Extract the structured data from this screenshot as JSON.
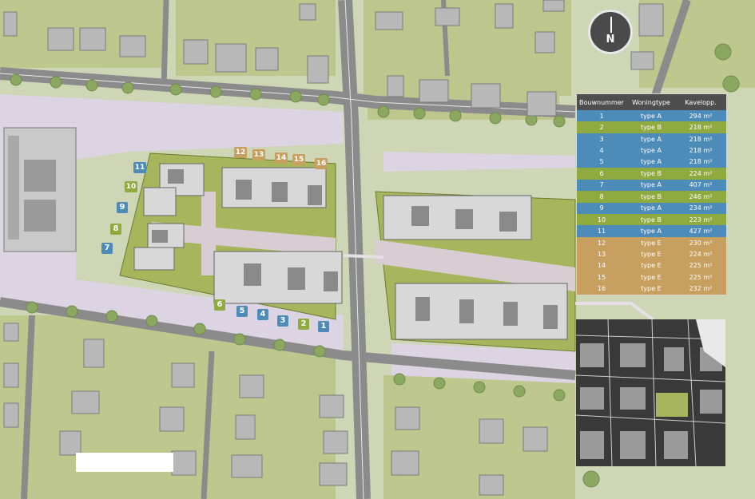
{
  "compass": {
    "letter": "N"
  },
  "colors": {
    "typeA": "#4d8bb8",
    "typeB": "#8faa3e",
    "typeE": "#c7a060",
    "street": "#e3dde8",
    "grass": "#cfd6b5",
    "parcel": "#a7b65d",
    "house": "#d9d9d9",
    "roof": "#8a8a8a"
  },
  "legend": {
    "headers": [
      "Bouwnummer",
      "Woningtype",
      "Kavelopp."
    ],
    "rows": [
      {
        "nr": "1",
        "type": "type A",
        "area": "294 m²",
        "color": "#4d8bb8"
      },
      {
        "nr": "2",
        "type": "type B",
        "area": "218 m²",
        "color": "#8faa3e"
      },
      {
        "nr": "3",
        "type": "type A",
        "area": "218 m²",
        "color": "#4d8bb8"
      },
      {
        "nr": "4",
        "type": "type A",
        "area": "218 m²",
        "color": "#4d8bb8"
      },
      {
        "nr": "5",
        "type": "type A",
        "area": "218 m²",
        "color": "#4d8bb8"
      },
      {
        "nr": "6",
        "type": "type B",
        "area": "224 m²",
        "color": "#8faa3e"
      },
      {
        "nr": "7",
        "type": "type A",
        "area": "407 m²",
        "color": "#4d8bb8"
      },
      {
        "nr": "8",
        "type": "type B",
        "area": "246 m²",
        "color": "#8faa3e"
      },
      {
        "nr": "9",
        "type": "type A",
        "area": "234 m²",
        "color": "#4d8bb8"
      },
      {
        "nr": "10",
        "type": "type B",
        "area": "223 m²",
        "color": "#8faa3e"
      },
      {
        "nr": "11",
        "type": "type A",
        "area": "427 m²",
        "color": "#4d8bb8"
      },
      {
        "nr": "12",
        "type": "type E",
        "area": "230 m²",
        "color": "#c7a060"
      },
      {
        "nr": "13",
        "type": "type E",
        "area": "224 m²",
        "color": "#c7a060"
      },
      {
        "nr": "14",
        "type": "type E",
        "area": "225 m²",
        "color": "#c7a060"
      },
      {
        "nr": "15",
        "type": "type E",
        "area": "225 m²",
        "color": "#c7a060"
      },
      {
        "nr": "16",
        "type": "type E",
        "area": "232 m²",
        "color": "#c7a060"
      }
    ]
  },
  "plot_labels": [
    {
      "nr": "1",
      "color": "#4d8bb8"
    },
    {
      "nr": "2",
      "color": "#8faa3e"
    },
    {
      "nr": "3",
      "color": "#4d8bb8"
    },
    {
      "nr": "4",
      "color": "#4d8bb8"
    },
    {
      "nr": "5",
      "color": "#4d8bb8"
    },
    {
      "nr": "6",
      "color": "#8faa3e"
    },
    {
      "nr": "7",
      "color": "#4d8bb8"
    },
    {
      "nr": "8",
      "color": "#8faa3e"
    },
    {
      "nr": "9",
      "color": "#4d8bb8"
    },
    {
      "nr": "10",
      "color": "#8faa3e"
    },
    {
      "nr": "11",
      "color": "#4d8bb8"
    },
    {
      "nr": "12",
      "color": "#c7a060"
    },
    {
      "nr": "13",
      "color": "#c7a060"
    },
    {
      "nr": "14",
      "color": "#c7a060"
    },
    {
      "nr": "15",
      "color": "#c7a060"
    },
    {
      "nr": "16",
      "color": "#c7a060"
    }
  ]
}
